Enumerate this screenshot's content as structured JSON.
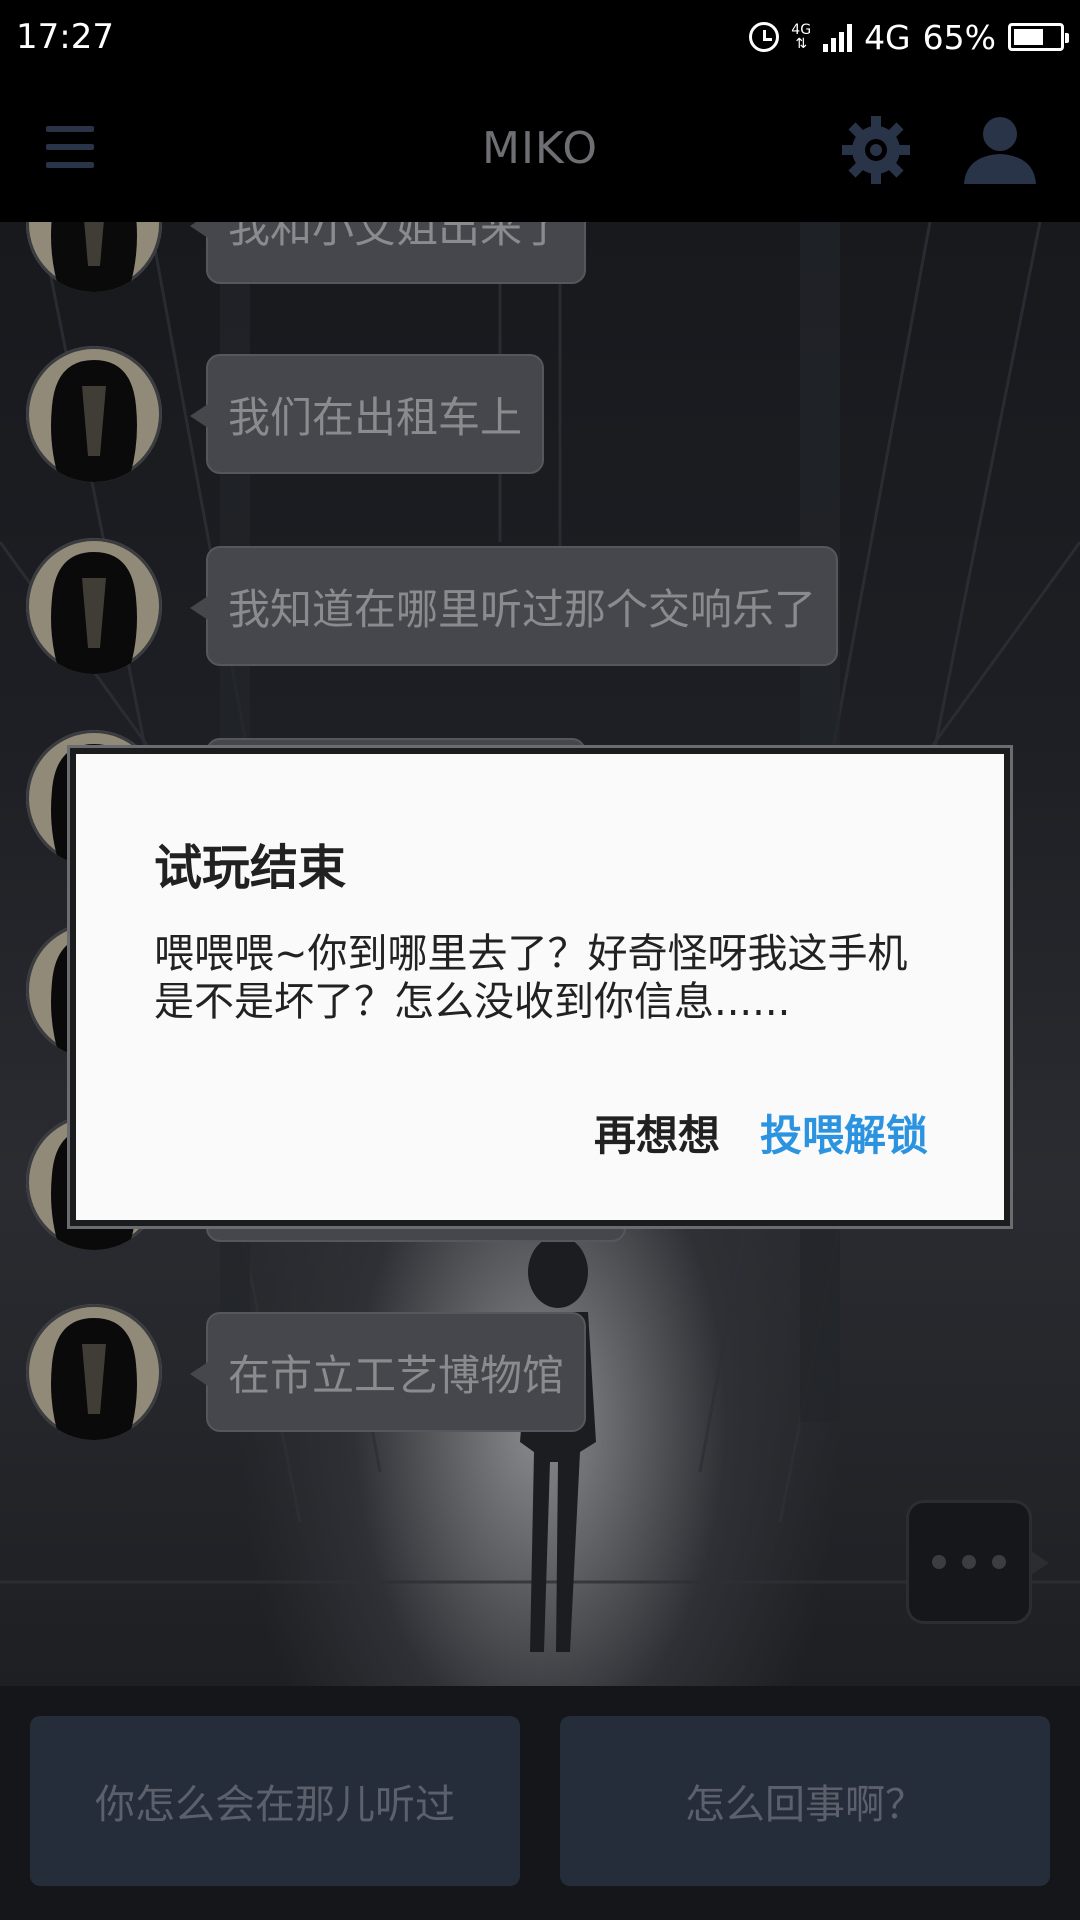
{
  "status_bar": {
    "time": "17:27",
    "network_small": "4G",
    "network": "4G",
    "battery": "65%",
    "battery_level": 0.65
  },
  "header": {
    "title": "MIKO",
    "menu_icon": "menu-icon",
    "settings_icon": "gear-icon",
    "profile_icon": "user-icon"
  },
  "messages": [
    {
      "text": "我和小艾姐出来了"
    },
    {
      "text": "我们在出租车上"
    },
    {
      "text": "我知道在哪里听过那个交响乐了"
    },
    {
      "text": ""
    },
    {
      "text": ""
    },
    {
      "text": ""
    },
    {
      "text": "在市立工艺博物馆"
    }
  ],
  "dialog": {
    "title": "试玩结束",
    "message": "喂喂喂~你到哪里去了？好奇怪呀我这手机是不是坏了？怎么没收到你信息......",
    "negative_button": "再想想",
    "positive_button": "投喂解锁"
  },
  "choices": [
    {
      "label": "你怎么会在那儿听过"
    },
    {
      "label": "怎么回事啊？"
    }
  ],
  "colors": {
    "accent": "#2b93e0",
    "choice_bg": "#252c3a",
    "bubble_bg": "#45474c"
  }
}
